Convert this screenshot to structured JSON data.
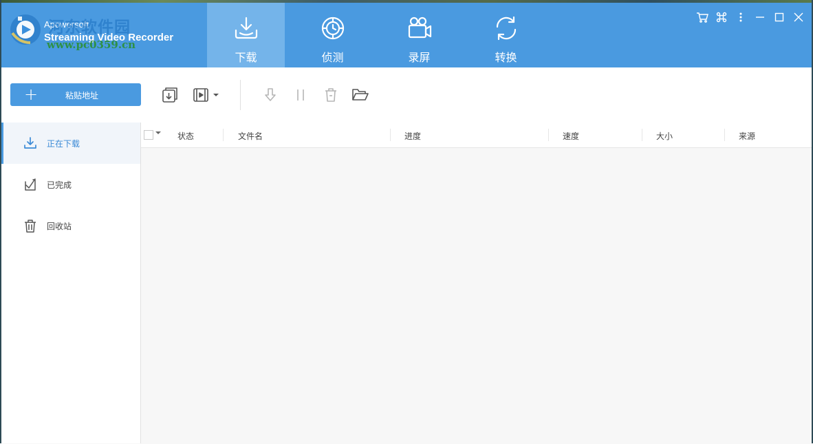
{
  "app": {
    "vendor": "Apowersoft",
    "title": "Streaming Video Recorder",
    "watermark_cn": "河东软件园",
    "watermark_url": "www.pc0359.cn"
  },
  "nav": {
    "tabs": [
      {
        "label": "下载",
        "icon": "download-tray-icon",
        "active": true
      },
      {
        "label": "侦测",
        "icon": "detect-target-icon",
        "active": false
      },
      {
        "label": "录屏",
        "icon": "video-camera-icon",
        "active": false
      },
      {
        "label": "转换",
        "icon": "convert-cycle-icon",
        "active": false
      }
    ]
  },
  "window_controls": [
    "cart-icon",
    "command-icon",
    "more-vertical-icon",
    "minimize-icon",
    "maximize-icon",
    "close-icon"
  ],
  "toolbar": {
    "paste_label": "粘贴地址",
    "icons": [
      "import-download-icon",
      "video-file-icon",
      "dropdown-arrow-icon",
      "resume-download-icon",
      "pause-icon",
      "delete-icon",
      "open-folder-icon"
    ]
  },
  "sidebar": {
    "items": [
      {
        "label": "正在下载",
        "icon": "download-icon",
        "active": true
      },
      {
        "label": "已完成",
        "icon": "completed-check-icon",
        "active": false
      },
      {
        "label": "回收站",
        "icon": "trash-icon",
        "active": false
      }
    ]
  },
  "table": {
    "columns": [
      "状态",
      "文件名",
      "进度",
      "速度",
      "大小",
      "来源"
    ],
    "rows": []
  },
  "colors": {
    "header": "#4a9ae0",
    "active_tab": "#74b4ea",
    "accent": "#4a9ae0"
  }
}
